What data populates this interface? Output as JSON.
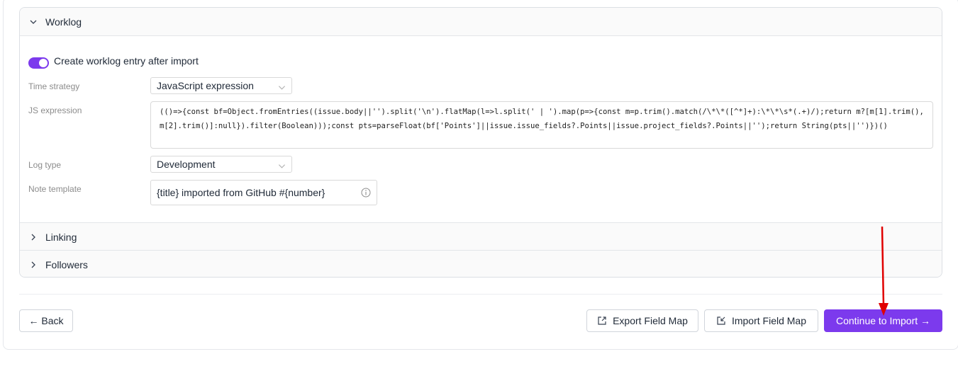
{
  "worklog": {
    "title": "Worklog",
    "toggle_label": "Create worklog entry after import",
    "toggle_on": true,
    "time_strategy_label": "Time strategy",
    "time_strategy_value": "JavaScript expression",
    "js_label": "JS expression",
    "js_value": "(()=>{const bf=Object.fromEntries((issue.body||'').split('\\n').flatMap(l=>l.split(' | ').map(p=>{const m=p.trim().match(/\\*\\*([^*]+):\\*\\*\\s*(.+)/);return m?[m[1].trim(),m[2].trim()]:null}).filter(Boolean)));const pts=parseFloat(bf['Points']||issue.issue_fields?.Points||issue.project_fields?.Points||'');return String(pts||'')})()",
    "log_type_label": "Log type",
    "log_type_value": "Development",
    "note_label": "Note template",
    "note_value": "{title} imported from GitHub #{number}"
  },
  "sections": {
    "linking": "Linking",
    "followers": "Followers"
  },
  "footer": {
    "back_label": "← Back",
    "export_label": "Export Field Map",
    "import_label": "Import Field Map",
    "continue_label": "Continue to Import →"
  },
  "colors": {
    "accent": "#7c3aed",
    "annotation_arrow": "#e00000"
  },
  "icons": {
    "chevron_down": "chevron-down-icon",
    "chevron_right": "chevron-right-icon",
    "info": "info-icon",
    "export": "export-icon",
    "import": "import-icon"
  }
}
